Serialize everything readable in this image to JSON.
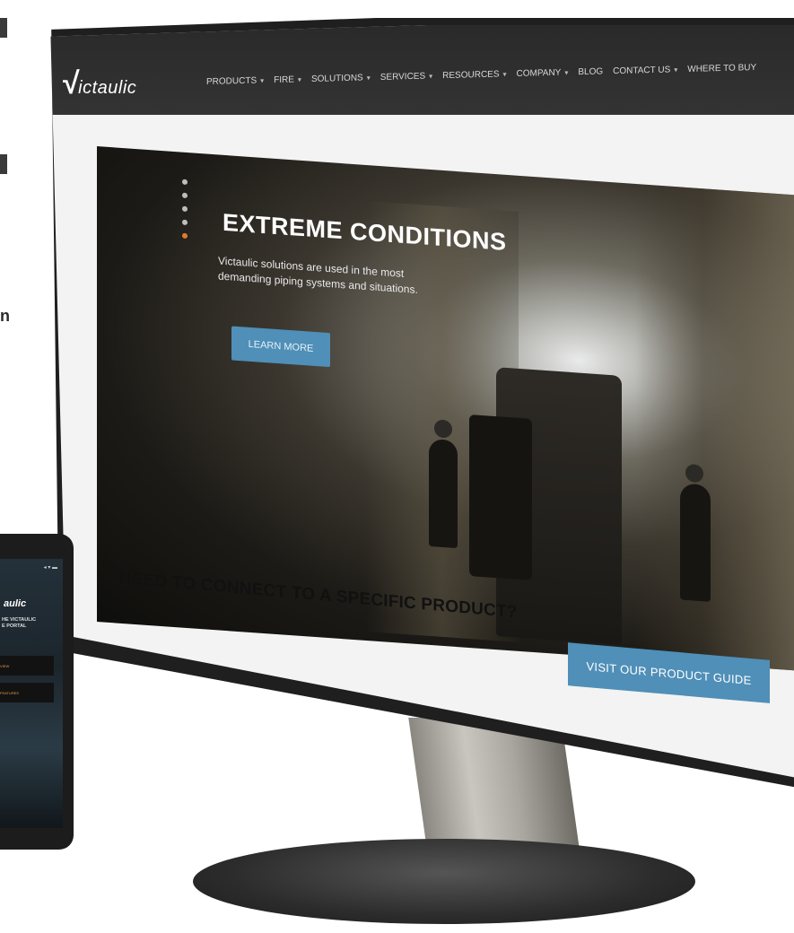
{
  "left_fragments": {
    "frag_1": "n"
  },
  "site": {
    "logo": "ictaulic",
    "logo_mark": "√",
    "nav": [
      {
        "label": "PRODUCTS",
        "dropdown": true
      },
      {
        "label": "FIRE",
        "dropdown": true
      },
      {
        "label": "SOLUTIONS",
        "dropdown": true
      },
      {
        "label": "SERVICES",
        "dropdown": true
      },
      {
        "label": "RESOURCES",
        "dropdown": true
      },
      {
        "label": "COMPANY",
        "dropdown": true
      },
      {
        "label": "BLOG",
        "dropdown": false
      },
      {
        "label": "CONTACT US",
        "dropdown": true
      },
      {
        "label": "WHERE TO BUY",
        "dropdown": false
      }
    ],
    "dropdown_glyph": "▾",
    "hero": {
      "title": "EXTREME CONDITIONS",
      "subtitle": "Victaulic solutions are used in the most demanding piping systems and situations.",
      "button": "LEARN MORE",
      "slides": 5,
      "active_slide_index": 4
    },
    "connect_heading": "NEED TO CONNECT TO A SPECIFIC PRODUCT?",
    "guide_button": "VISIT OUR PRODUCT GUIDE",
    "accent_color": "#4f8fb8",
    "active_dot_color": "#e07a2e"
  },
  "phone": {
    "status": "◂ ▾ ▬",
    "logo": "aulic",
    "title_line_1": "HE VICTAULIC",
    "title_line_2": "E PORTAL",
    "button_1": "VIEW",
    "button_2": "FEATURES"
  }
}
